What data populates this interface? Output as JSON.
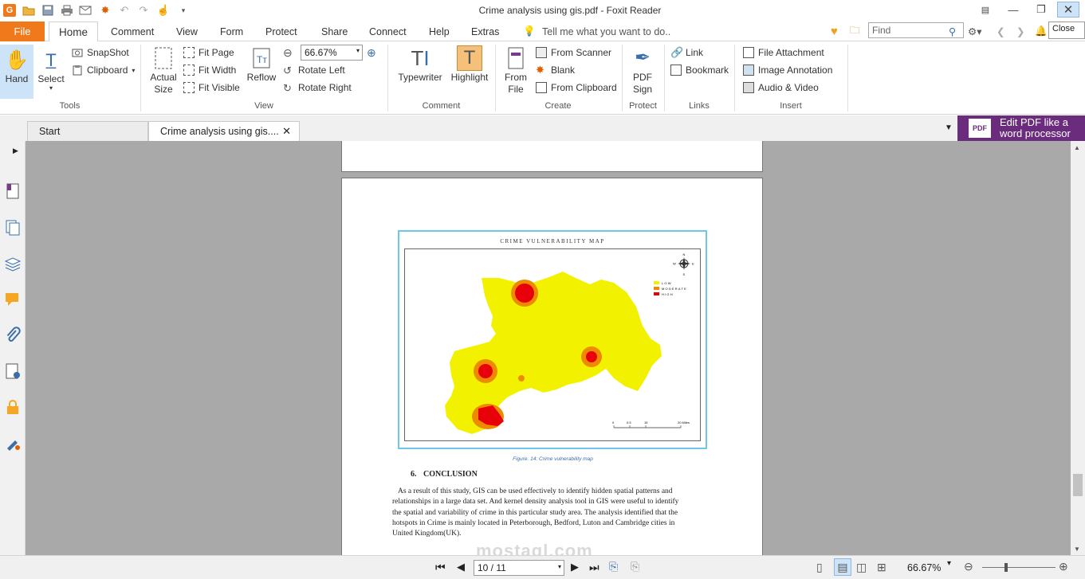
{
  "window": {
    "title": "Crime analysis using gis.pdf - Foxit Reader",
    "close_tooltip": "Close"
  },
  "menu": {
    "file": "File",
    "tabs": [
      "Home",
      "Comment",
      "View",
      "Form",
      "Protect",
      "Share",
      "Connect",
      "Help",
      "Extras"
    ],
    "tell_me": "Tell me what you want to do..",
    "find_placeholder": "Find"
  },
  "ribbon": {
    "tools": {
      "hand": "Hand",
      "select": "Select",
      "snapshot": "SnapShot",
      "clipboard": "Clipboard",
      "group": "Tools"
    },
    "view": {
      "actual": "Actual",
      "size": "Size",
      "fit_page": "Fit Page",
      "fit_width": "Fit Width",
      "fit_visible": "Fit Visible",
      "reflow": "Reflow",
      "zoom": "66.67%",
      "rotate_left": "Rotate Left",
      "rotate_right": "Rotate Right",
      "group": "View"
    },
    "comment": {
      "typewriter": "Typewriter",
      "highlight": "Highlight",
      "group": "Comment"
    },
    "create": {
      "from": "From",
      "file": "File",
      "from_scanner": "From Scanner",
      "blank": "Blank",
      "from_clipboard": "From Clipboard",
      "group": "Create"
    },
    "protect": {
      "pdf": "PDF",
      "sign": "Sign",
      "group": "Protect"
    },
    "links": {
      "link": "Link",
      "bookmark": "Bookmark",
      "group": "Links"
    },
    "insert": {
      "file_attachment": "File Attachment",
      "image_annotation": "Image Annotation",
      "audio_video": "Audio & Video",
      "group": "Insert"
    }
  },
  "doctabs": {
    "start": "Start",
    "current": "Crime analysis using gis....",
    "promo_line1": "Edit PDF like a",
    "promo_line2": "word processor",
    "promo_badge": "PDF"
  },
  "document": {
    "map_title": "CRIME VULNERABILITY MAP",
    "legend": [
      "LOW",
      "MODERATE",
      "HIGH"
    ],
    "scale": [
      "0",
      "0.5",
      "15",
      "20 Miles"
    ],
    "compass": {
      "n": "N",
      "s": "S",
      "e": "E",
      "w": "W"
    },
    "caption": "Figure. 14: Crime vulnerability map",
    "heading_num": "6.",
    "heading": "CONCLUSION",
    "body": [
      "As a result of this study, GIS can be used effectively to identify hidden spatial patterns and",
      "relationships in a large data set. And kernel density analysis tool in GIS were useful to identify",
      "the spatial and variability of crime in this particular study area. The analysis identified that the",
      "hotspots in Crime is mainly located in Peterborough, Bedford, Luton and Cambridge cities in",
      "United Kingdom(UK)."
    ],
    "watermark": "mostaql.com"
  },
  "status": {
    "page": "10 / 11",
    "zoom": "66.67%"
  },
  "colors": {
    "accent": "#f07a1b",
    "purple": "#6b2c7d",
    "map_low": "#f2f200",
    "map_moderate": "#ee8a00",
    "map_high": "#e8000a",
    "map_frame": "#6ec6e8"
  }
}
